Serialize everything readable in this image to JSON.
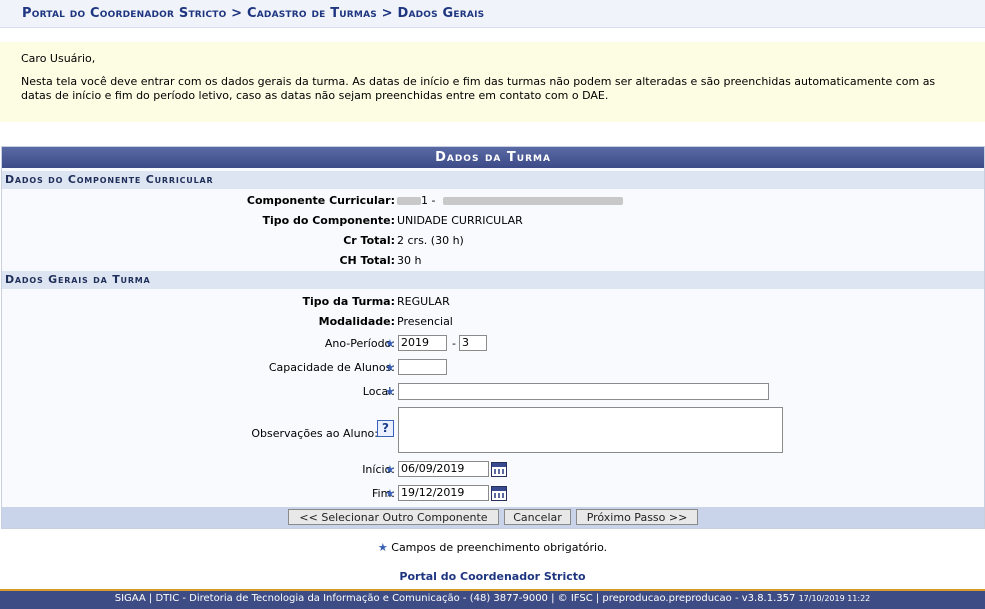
{
  "breadcrumb": "Portal do Coordenador Stricto > Cadastro de Turmas > Dados Gerais",
  "notice": {
    "greeting": "Caro Usuário,",
    "message": "Nesta tela você deve entrar com os dados gerais da turma. As datas de início e fim das turmas não podem ser alteradas e são preenchidas automaticamente com as datas de início e fim do período letivo, caso as datas não sejam preenchidas entre em contato com o DAE."
  },
  "panel": {
    "title": "Dados da Turma",
    "componente_section": "Dados do Componente Curricular",
    "gerais_section": "Dados Gerais da Turma"
  },
  "componente": {
    "componente_label": "Componente Curricular:",
    "componente_value": "1 -",
    "tipo_label": "Tipo do Componente:",
    "tipo_value": "UNIDADE CURRICULAR",
    "cr_label": "Cr Total:",
    "cr_value": "2 crs. (30 h)",
    "ch_label": "CH Total:",
    "ch_value": "30 h"
  },
  "turma": {
    "tipo_label": "Tipo da Turma:",
    "tipo_value": "REGULAR",
    "modalidade_label": "Modalidade:",
    "modalidade_value": "Presencial",
    "ano_periodo_label": "Ano-Período:",
    "ano_value": "2019",
    "periodo_sep": "-",
    "periodo_value": "3",
    "capacidade_label": "Capacidade de Alunos:",
    "capacidade_value": "",
    "local_label": "Local:",
    "local_value": "",
    "obs_label": "Observações ao Aluno:",
    "obs_value": "",
    "help_glyph": "?",
    "inicio_label": "Início:",
    "inicio_value": "06/09/2019",
    "fim_label": "Fim:",
    "fim_value": "19/12/2019"
  },
  "buttons": {
    "selecionar": "<< Selecionar Outro Componente",
    "cancelar": "Cancelar",
    "proximo": "Próximo Passo >>"
  },
  "required_star": "★",
  "legend_text": "Campos de preenchimento obrigatório.",
  "portal_link": "Portal do Coordenador Stricto",
  "footer": {
    "text": "SIGAA | DTIC - Diretoria de Tecnologia da Informação e Comunicação - (48) 3877-9000 | © IFSC | preproducao.preproducao - v3.8.1.357",
    "timestamp": "17/10/2019 11:22"
  },
  "colors": {
    "brand": "#1e3580",
    "header_bar": "#3e4c86",
    "accent_border": "#d99a2c",
    "notice_bg": "#fdfde4"
  },
  "icons": [
    "help-icon",
    "calendar-icon",
    "required-star-icon"
  ]
}
